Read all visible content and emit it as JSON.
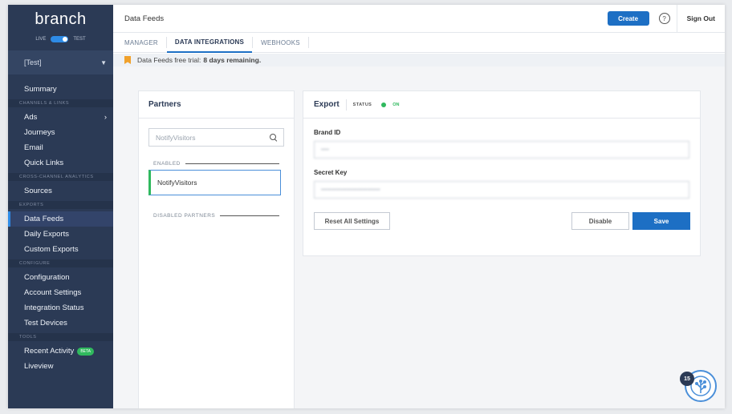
{
  "sidebar": {
    "logo": "branch",
    "env": {
      "live": "LIVE",
      "test": "TEST"
    },
    "app": "[Test]",
    "sections": [
      {
        "label": "",
        "items": [
          "Summary"
        ]
      },
      {
        "label": "CHANNELS & LINKS",
        "items": [
          "Ads",
          "Journeys",
          "Email",
          "Quick Links"
        ]
      },
      {
        "label": "CROSS-CHANNEL ANALYTICS",
        "items": [
          "Sources"
        ]
      },
      {
        "label": "EXPORTS",
        "items": [
          "Data Feeds",
          "Daily Exports",
          "Custom Exports"
        ]
      },
      {
        "label": "CONFIGURE",
        "items": [
          "Configuration",
          "Account Settings",
          "Integration Status",
          "Test Devices"
        ]
      },
      {
        "label": "TOOLS",
        "items": [
          "Recent Activity",
          "Liveview"
        ]
      }
    ],
    "active_item": "Data Feeds",
    "beta_badge": "BETA"
  },
  "header": {
    "title": "Data Feeds",
    "create": "Create",
    "help": "?",
    "signout": "Sign Out"
  },
  "tabs": [
    "MANAGER",
    "DATA INTEGRATIONS",
    "WEBHOOKS"
  ],
  "active_tab": "DATA INTEGRATIONS",
  "trial": {
    "text": "Data Feeds free trial:",
    "remaining": "8 days remaining."
  },
  "partners": {
    "title": "Partners",
    "search_value": "NotifyVisitors",
    "enabled_label": "ENABLED",
    "enabled": [
      "NotifyVisitors"
    ],
    "disabled_label": "DISABLED PARTNERS"
  },
  "export": {
    "title": "Export",
    "status_label": "STATUS",
    "status_value": "ON",
    "brand_id_label": "Brand ID",
    "brand_id_value": "••••",
    "secret_key_label": "Secret Key",
    "secret_key_value": "••••••••••••••••••••••••••••••",
    "reset": "Reset All Settings",
    "disable": "Disable",
    "save": "Save"
  },
  "chat": {
    "badge": "15"
  },
  "colors": {
    "sidebar": "#2b3a55",
    "accent": "#1d6fc4",
    "on": "#30b95e",
    "trial": "#f0a12c"
  }
}
